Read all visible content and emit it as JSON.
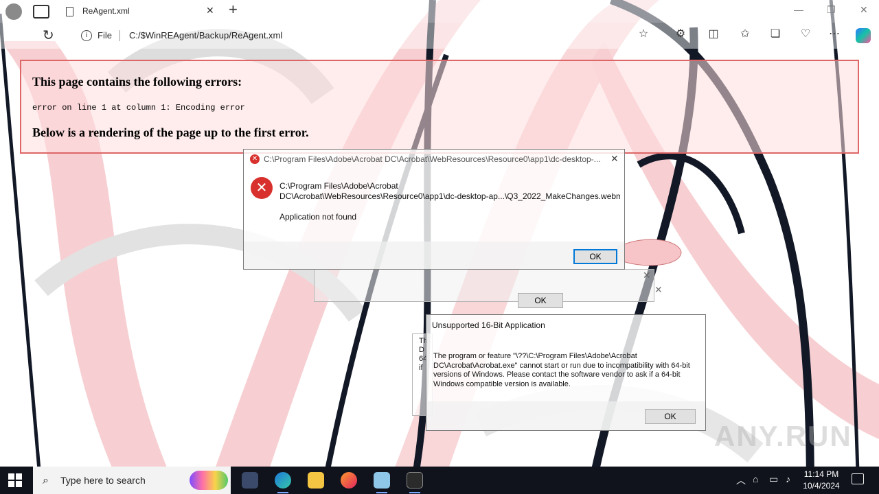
{
  "browser": {
    "tab_title": "ReAgent.xml",
    "tab_close": "✕",
    "new_tab": "+",
    "address_prefix": "File",
    "url": "C:/$WinREAgent/Backup/ReAgent.xml",
    "refresh_icon": "↻",
    "info_icon": "i",
    "minimize": "—",
    "restore": "❐",
    "close": "✕",
    "toolbar_icons": [
      "star-icon",
      "extensions-icon",
      "split-screen-icon",
      "favorites-icon",
      "collections-icon",
      "performance-icon",
      "more-icon",
      "copilot-icon"
    ]
  },
  "xml_error": {
    "heading": "This page contains the following errors:",
    "detail": "error on line 1 at column 1: Encoding error",
    "below": "Below is a rendering of the page up to the first error."
  },
  "dialog_app": {
    "title": "C:\\Program Files\\Adobe\\Acrobat DC\\Acrobat\\WebResources\\Resource0\\app1\\dc-desktop-...",
    "line1": "C:\\Program Files\\Adobe\\Acrobat",
    "line2": "DC\\Acrobat\\WebResources\\Resource0\\app1\\dc-desktop-ap...\\Q3_2022_MakeChanges.webm",
    "message": "Application not found",
    "ok": "OK",
    "close_glyph": "✕"
  },
  "dialog_back": {
    "ok": "OK",
    "close_glyph": "✕"
  },
  "dialog_stack": {
    "lines": [
      "Th",
      "D",
      "64",
      "if"
    ]
  },
  "dialog_16bit": {
    "title": "Unsupported 16-Bit Application",
    "body": "The program or feature \"\\??\\C:\\Program Files\\Adobe\\Acrobat DC\\Acrobat\\Acrobat.exe\" cannot start or run due to incompatibility with 64-bit versions of Windows. Please contact the software vendor to ask if a 64-bit Windows compatible version is available.",
    "ok": "OK"
  },
  "watermark": "ANY.RUN",
  "taskbar": {
    "search_placeholder": "Type here to search",
    "time": "11:14 PM",
    "date": "10/4/2024",
    "apps": [
      "task-view-icon",
      "edge-icon",
      "file-explorer-icon",
      "firefox-icon",
      "notepad-icon",
      "terminal-icon"
    ],
    "tray_chevron": "︿"
  },
  "colors": {
    "error_red": "#d8302c",
    "accent_blue": "#0078d7",
    "taskbar_bg": "#10131c",
    "xml_error_border": "#dd6666"
  }
}
